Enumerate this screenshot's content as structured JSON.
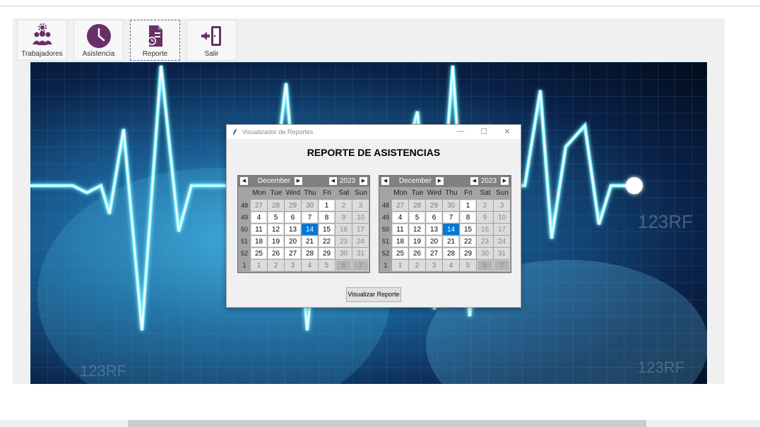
{
  "toolbar": {
    "items": [
      {
        "label": "Trabajadores",
        "icon": "workers-gear-icon"
      },
      {
        "label": "Asistencia",
        "icon": "clock-icon"
      },
      {
        "label": "Reporte",
        "icon": "report-icon"
      },
      {
        "label": "Salir",
        "icon": "exit-door-icon"
      }
    ],
    "icon_color": "#6a2f68"
  },
  "dialog": {
    "title": "Visualizador de Reportes",
    "controls": {
      "minimize": "—",
      "maximize": "☐",
      "close": "✕"
    },
    "heading": "REPORTE DE ASISTENCIAS",
    "button_label": "Visualizar Reporte"
  },
  "calendar": {
    "month": "December",
    "year": "2023",
    "weekdays": [
      "Mon",
      "Tue",
      "Wed",
      "Thu",
      "Fri",
      "Sat",
      "Sun"
    ],
    "selected_day": "14",
    "weeks": [
      {
        "num": "48",
        "days": [
          "27",
          "28",
          "29",
          "30",
          "1",
          "2",
          "3"
        ]
      },
      {
        "num": "49",
        "days": [
          "4",
          "5",
          "6",
          "7",
          "8",
          "9",
          "10"
        ]
      },
      {
        "num": "50",
        "days": [
          "11",
          "12",
          "13",
          "14",
          "15",
          "16",
          "17"
        ]
      },
      {
        "num": "51",
        "days": [
          "18",
          "19",
          "20",
          "21",
          "22",
          "23",
          "24"
        ]
      },
      {
        "num": "52",
        "days": [
          "25",
          "26",
          "27",
          "28",
          "29",
          "30",
          "31"
        ]
      },
      {
        "num": "1",
        "days": [
          "1",
          "2",
          "3",
          "4",
          "5",
          "6",
          "7"
        ]
      }
    ]
  },
  "background": {
    "watermark": "123RF"
  }
}
